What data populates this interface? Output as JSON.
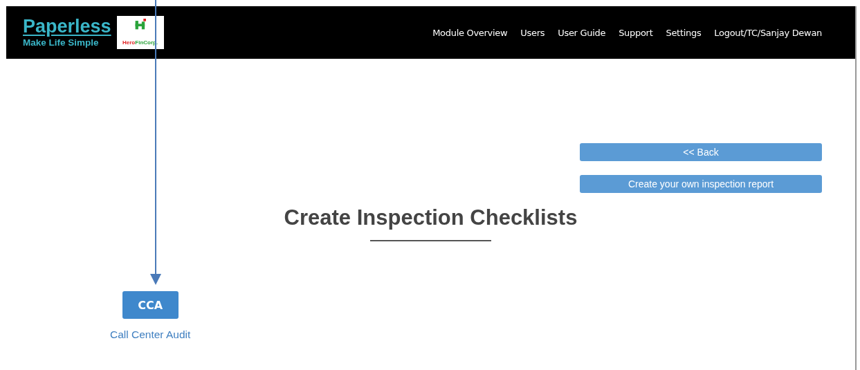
{
  "brand": {
    "title": "Paperless",
    "tagline": "Make Life Simple",
    "partner_logo": {
      "part_1": "Hero",
      "part_2": "FinCorp."
    }
  },
  "nav": [
    {
      "label": "Module Overview"
    },
    {
      "label": "Users"
    },
    {
      "label": "User Guide"
    },
    {
      "label": "Support"
    },
    {
      "label": "Settings"
    },
    {
      "label": "Logout/TC/Sanjay Dewan"
    }
  ],
  "actions": [
    {
      "label": "<< Back"
    },
    {
      "label": "Create your own inspection report"
    }
  ],
  "heading": "Create Inspection Checklists",
  "checklists": [
    {
      "code": "CCA",
      "name": "Call Center Audit"
    }
  ]
}
